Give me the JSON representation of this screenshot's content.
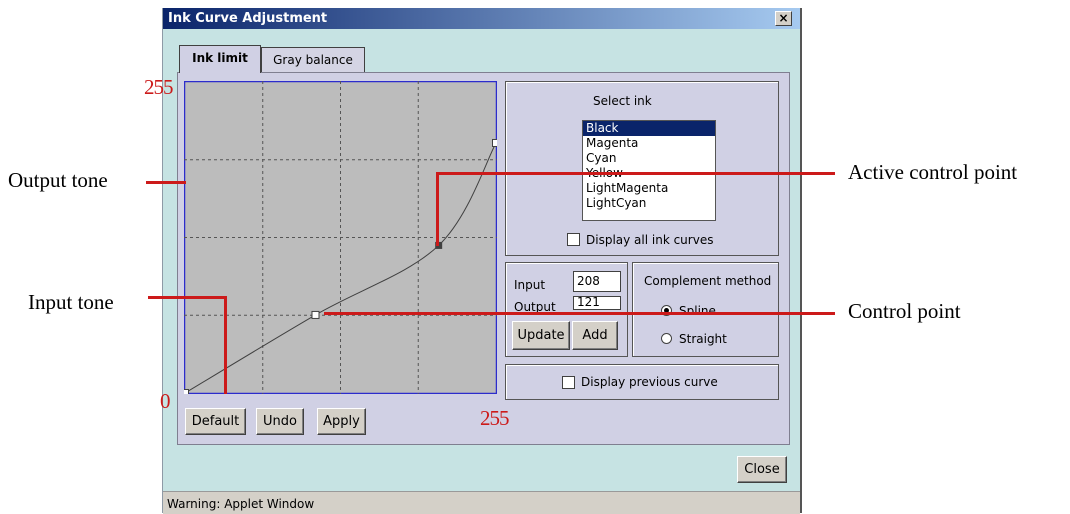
{
  "window": {
    "title": "Ink Curve Adjustment",
    "close_glyph": "×"
  },
  "tabs": [
    {
      "label": "Ink limit",
      "active": true
    },
    {
      "label": "Gray balance",
      "active": false
    }
  ],
  "graph": {
    "grid_lines": "dashed",
    "background": "#bcbcbc",
    "border_color": "#2c2ccc",
    "control_points": [
      {
        "input": 0,
        "output": 0,
        "active": false
      },
      {
        "input": 107,
        "output": 64,
        "active": false
      },
      {
        "input": 208,
        "output": 121,
        "active": true
      },
      {
        "input": 255,
        "output": 205,
        "active": false
      }
    ]
  },
  "buttons": {
    "default": "Default",
    "undo": "Undo",
    "apply": "Apply",
    "update": "Update",
    "add": "Add",
    "close": "Close"
  },
  "select_ink": {
    "label": "Select ink",
    "items": [
      "Black",
      "Magenta",
      "Cyan",
      "Yellow",
      "LightMagenta",
      "LightCyan"
    ],
    "selected": "Black"
  },
  "display_all_ink_curves": {
    "label": "Display all ink curves",
    "checked": false
  },
  "input_output": {
    "input_label": "Input",
    "input_value": "208",
    "output_label": "Output",
    "output_value": "121"
  },
  "complement_method": {
    "label": "Complement method",
    "options": [
      {
        "label": "Spline",
        "selected": true
      },
      {
        "label": "Straight",
        "selected": false
      }
    ]
  },
  "display_previous_curve": {
    "label": "Display previous curve",
    "checked": false
  },
  "status_bar": "Warning: Applet Window",
  "annotations": {
    "y_max": "255",
    "origin": "0",
    "x_max": "255",
    "output_tone": "Output tone",
    "input_tone": "Input tone",
    "active_control_point": "Active control point",
    "control_point": "Control point",
    "line_color": "#cc1a1a"
  }
}
